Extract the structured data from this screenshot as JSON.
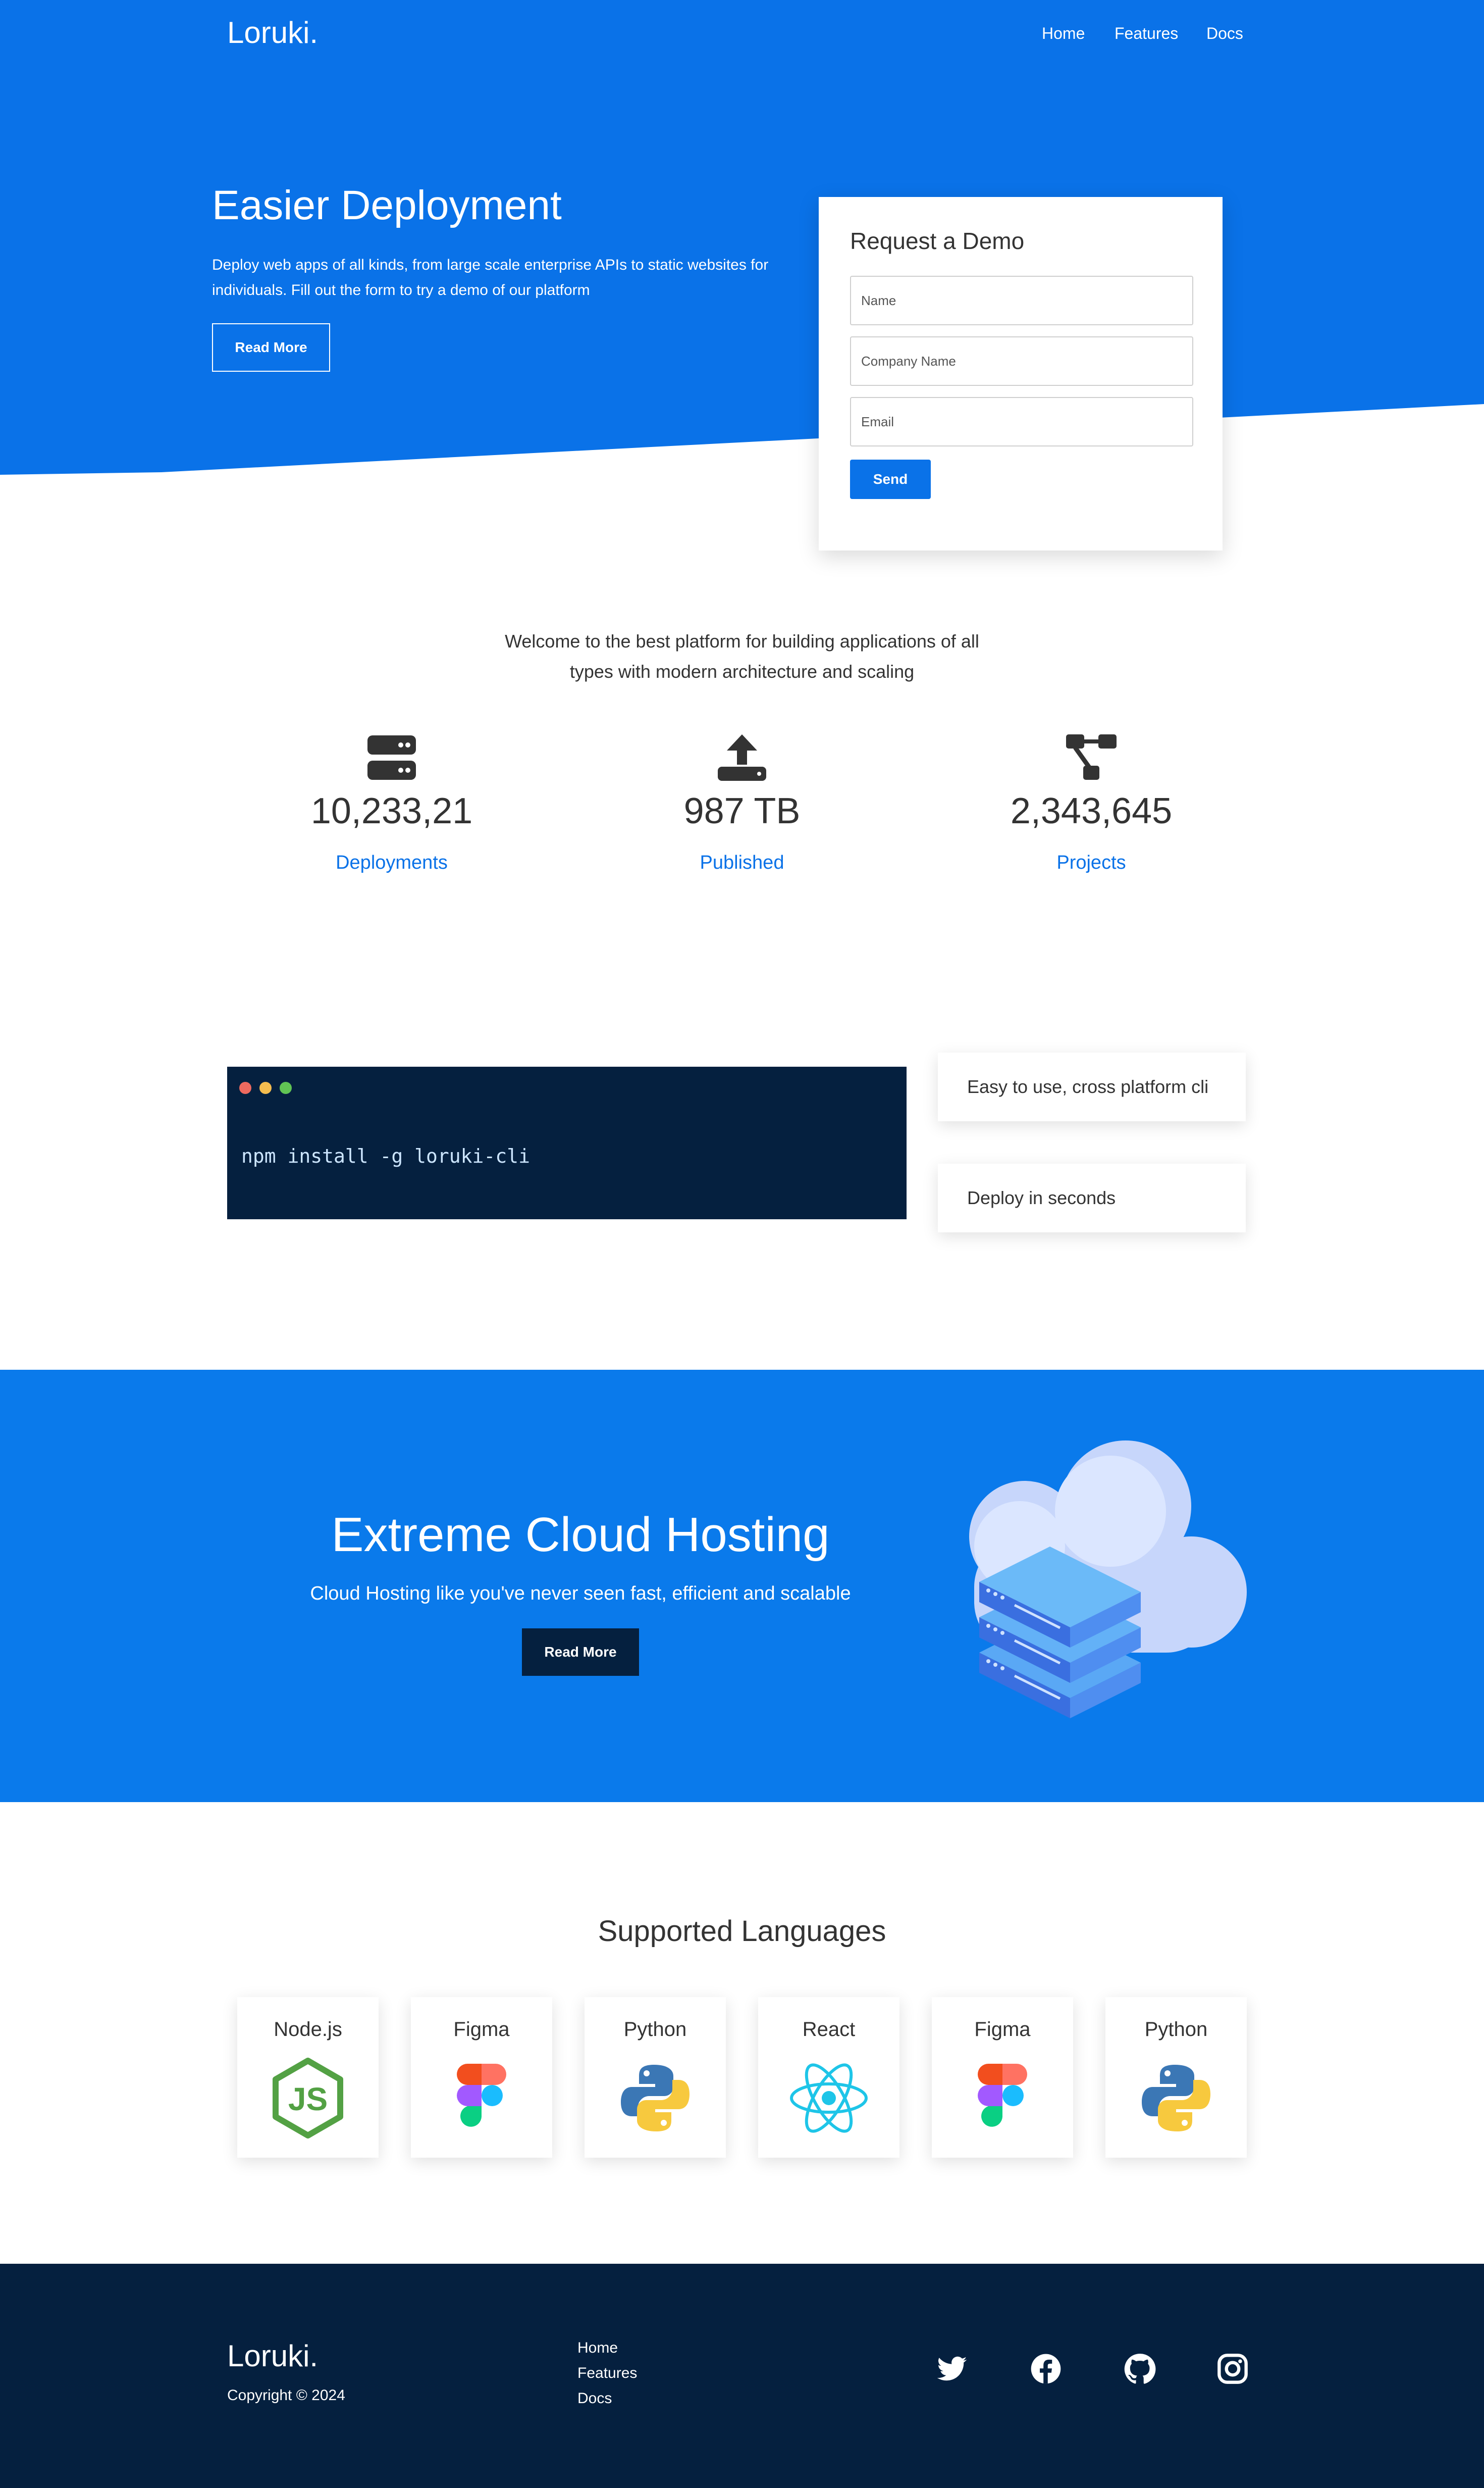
{
  "header": {
    "brand": "Loruki.",
    "nav": [
      "Home",
      "Features",
      "Docs"
    ]
  },
  "hero": {
    "title": "Easier Deployment",
    "text": "Deploy web apps of all kinds, from large scale enterprise APIs to static websites for individuals. Fill out the form to try a demo of our platform",
    "button": "Read More"
  },
  "demo_form": {
    "title": "Request a Demo",
    "name_placeholder": "Name",
    "company_placeholder": "Company Name",
    "email_placeholder": "Email",
    "submit": "Send"
  },
  "stats": {
    "intro": "Welcome to the best platform for building applications of all types with modern architecture and scaling",
    "items": [
      {
        "icon": "server-icon",
        "value": "10,233,21",
        "label": "Deployments"
      },
      {
        "icon": "upload-icon",
        "value": "987 TB",
        "label": "Published"
      },
      {
        "icon": "project-diagram-icon",
        "value": "2,343,645",
        "label": "Projects"
      }
    ]
  },
  "cli": {
    "command": "npm install -g loruki-cli",
    "features": [
      "Easy to use, cross platform cli",
      "Deploy in seconds"
    ]
  },
  "cloud": {
    "title": "Extreme Cloud Hosting",
    "subtitle": "Cloud Hosting like you've never seen fast, efficient and scalable",
    "button": "Read More"
  },
  "languages": {
    "title": "Supported Languages",
    "items": [
      {
        "name": "Node.js",
        "icon": "nodejs-icon"
      },
      {
        "name": "Figma",
        "icon": "figma-icon"
      },
      {
        "name": "Python",
        "icon": "python-icon"
      },
      {
        "name": "React",
        "icon": "react-icon"
      },
      {
        "name": "Figma",
        "icon": "figma-icon"
      },
      {
        "name": "Python",
        "icon": "python-icon"
      }
    ]
  },
  "footer": {
    "brand": "Loruki.",
    "copyright": "Copyright © 2024",
    "links": [
      "Home",
      "Features",
      "Docs"
    ],
    "social": [
      "twitter-icon",
      "facebook-icon",
      "github-icon",
      "instagram-icon"
    ]
  },
  "colors": {
    "primary": "#0a72e8",
    "dark": "#05203f",
    "cloud_band": "#0a7aeb"
  }
}
